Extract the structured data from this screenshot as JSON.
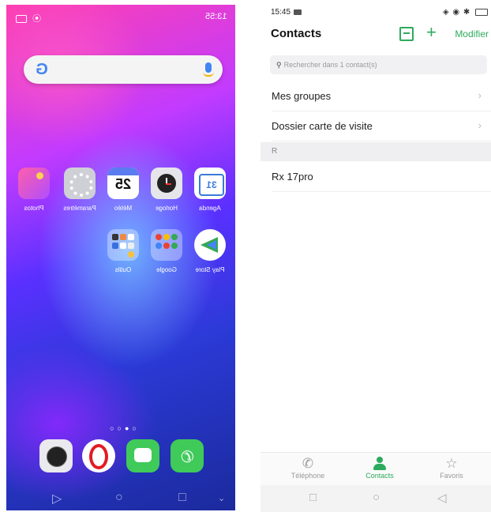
{
  "home": {
    "status_time": "13:55",
    "apps_row1": [
      {
        "label": "Agenda",
        "icon": "calendar-icon",
        "text": "31"
      },
      {
        "label": "Horloge",
        "icon": "clock-icon",
        "text": ""
      },
      {
        "label": "Météo",
        "icon": "weather-icon",
        "text": "25"
      },
      {
        "label": "Paramètres",
        "icon": "settings-icon",
        "text": ""
      },
      {
        "label": "Photos",
        "icon": "photos-icon",
        "text": ""
      }
    ],
    "apps_row2": [
      {
        "label": "Play Store",
        "icon": "play-store-icon"
      },
      {
        "label": "Google",
        "icon": "google-folder-icon"
      },
      {
        "label": "Outils",
        "icon": "tools-folder-icon"
      }
    ],
    "page_dots": "○○●○",
    "dock": [
      "phone-icon",
      "messages-icon",
      "opera-icon",
      "camera-icon"
    ]
  },
  "contacts": {
    "status_time": "15:45",
    "title": "Contacts",
    "edit_label": "Modifier",
    "search_placeholder": "Rechercher dans 1 contact(s)",
    "menu": [
      {
        "label": "Mes groupes"
      },
      {
        "label": "Dossier carte de visite"
      }
    ],
    "section_letter": "R",
    "entries": [
      {
        "name": "Rx 17pro"
      }
    ],
    "tabs": [
      {
        "label": "Téléphone",
        "icon": "phone-icon",
        "active": false
      },
      {
        "label": "Contacts",
        "icon": "person-icon",
        "active": true
      },
      {
        "label": "Favoris",
        "icon": "star-icon",
        "active": false
      }
    ],
    "accent_color": "#2cab5c"
  }
}
